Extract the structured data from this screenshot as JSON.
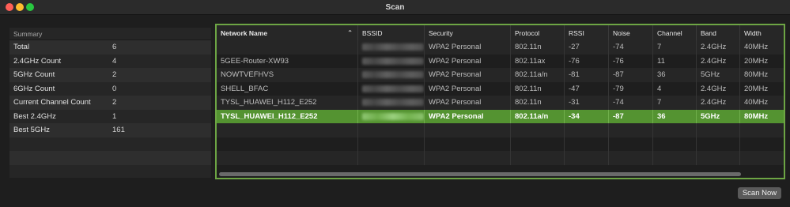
{
  "window": {
    "title": "Scan"
  },
  "summary": {
    "header": "Summary",
    "rows": [
      {
        "label": "Total",
        "value": "6"
      },
      {
        "label": "2.4GHz Count",
        "value": "4"
      },
      {
        "label": "5GHz Count",
        "value": "2"
      },
      {
        "label": "6GHz Count",
        "value": "0"
      },
      {
        "label": "Current Channel Count",
        "value": "2"
      },
      {
        "label": "Best 2.4GHz",
        "value": "1"
      },
      {
        "label": "Best 5GHz",
        "value": "161"
      }
    ]
  },
  "table": {
    "columns": [
      "Network Name",
      "BSSID",
      "Security",
      "Protocol",
      "RSSI",
      "Noise",
      "Channel",
      "Band",
      "Width"
    ],
    "sort_icon": "chevron-up-icon",
    "rows": [
      {
        "name": "",
        "bssid": "",
        "security": "WPA2 Personal",
        "protocol": "802.11n",
        "rssi": "-27",
        "noise": "-74",
        "channel": "7",
        "band": "2.4GHz",
        "width": "40MHz"
      },
      {
        "name": "5GEE-Router-XW93",
        "bssid": "",
        "security": "WPA2 Personal",
        "protocol": "802.11ax",
        "rssi": "-76",
        "noise": "-76",
        "channel": "11",
        "band": "2.4GHz",
        "width": "20MHz"
      },
      {
        "name": "NOWTVEFHVS",
        "bssid": "",
        "security": "WPA2 Personal",
        "protocol": "802.11a/n",
        "rssi": "-81",
        "noise": "-87",
        "channel": "36",
        "band": "5GHz",
        "width": "80MHz"
      },
      {
        "name": "SHELL_BFAC",
        "bssid": "",
        "security": "WPA2 Personal",
        "protocol": "802.11n",
        "rssi": "-47",
        "noise": "-79",
        "channel": "4",
        "band": "2.4GHz",
        "width": "20MHz"
      },
      {
        "name": "TYSL_HUAWEI_H112_E252",
        "bssid": "",
        "security": "WPA2 Personal",
        "protocol": "802.11n",
        "rssi": "-31",
        "noise": "-74",
        "channel": "7",
        "band": "2.4GHz",
        "width": "40MHz"
      },
      {
        "name": "TYSL_HUAWEI_H112_E252",
        "bssid": "",
        "security": "WPA2 Personal",
        "protocol": "802.11a/n",
        "rssi": "-34",
        "noise": "-87",
        "channel": "36",
        "band": "5GHz",
        "width": "80MHz",
        "selected": true
      }
    ]
  },
  "actions": {
    "scan_now": "Scan Now"
  },
  "colors": {
    "selection": "#549331",
    "focus_ring": "#6da544"
  }
}
